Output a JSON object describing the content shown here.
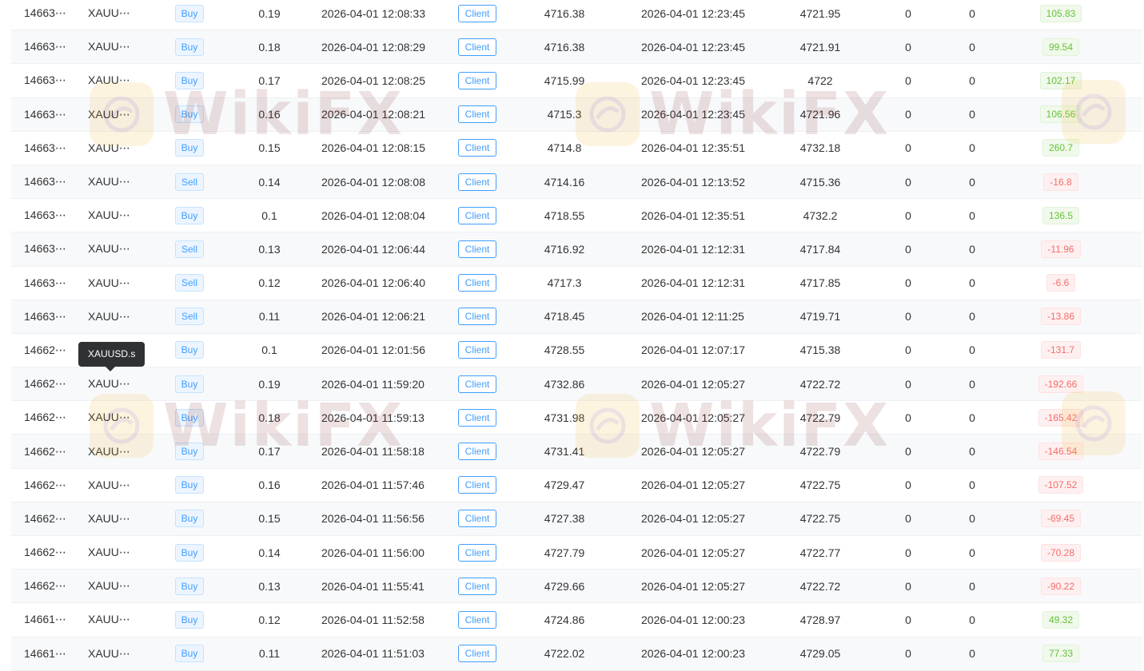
{
  "tooltip": {
    "text": "XAUUSD.s"
  },
  "watermark": {
    "text": "WikiFX"
  },
  "colors": {
    "primary": "#409eff",
    "profit": "#67c23a",
    "loss": "#f56c6c",
    "tooltip_bg": "#303133"
  },
  "rows": [
    {
      "id": "14663⋯",
      "symbol": "XAUU⋯",
      "type": "Buy",
      "volume": "0.19",
      "open_time": "2026-04-01 12:08:33",
      "source": "Client",
      "open_price": "4716.38",
      "close_time": "2026-04-01 12:23:45",
      "close_price": "4721.95",
      "swap": "0",
      "commission": "0",
      "profit": "105.83",
      "profit_sign": "pos"
    },
    {
      "id": "14663⋯",
      "symbol": "XAUU⋯",
      "type": "Buy",
      "volume": "0.18",
      "open_time": "2026-04-01 12:08:29",
      "source": "Client",
      "open_price": "4716.38",
      "close_time": "2026-04-01 12:23:45",
      "close_price": "4721.91",
      "swap": "0",
      "commission": "0",
      "profit": "99.54",
      "profit_sign": "pos"
    },
    {
      "id": "14663⋯",
      "symbol": "XAUU⋯",
      "type": "Buy",
      "volume": "0.17",
      "open_time": "2026-04-01 12:08:25",
      "source": "Client",
      "open_price": "4715.99",
      "close_time": "2026-04-01 12:23:45",
      "close_price": "4722",
      "swap": "0",
      "commission": "0",
      "profit": "102.17",
      "profit_sign": "pos"
    },
    {
      "id": "14663⋯",
      "symbol": "XAUU⋯",
      "type": "Buy",
      "volume": "0.16",
      "open_time": "2026-04-01 12:08:21",
      "source": "Client",
      "open_price": "4715.3",
      "close_time": "2026-04-01 12:23:45",
      "close_price": "4721.96",
      "swap": "0",
      "commission": "0",
      "profit": "106.56",
      "profit_sign": "pos"
    },
    {
      "id": "14663⋯",
      "symbol": "XAUU⋯",
      "type": "Buy",
      "volume": "0.15",
      "open_time": "2026-04-01 12:08:15",
      "source": "Client",
      "open_price": "4714.8",
      "close_time": "2026-04-01 12:35:51",
      "close_price": "4732.18",
      "swap": "0",
      "commission": "0",
      "profit": "260.7",
      "profit_sign": "pos"
    },
    {
      "id": "14663⋯",
      "symbol": "XAUU⋯",
      "type": "Sell",
      "volume": "0.14",
      "open_time": "2026-04-01 12:08:08",
      "source": "Client",
      "open_price": "4714.16",
      "close_time": "2026-04-01 12:13:52",
      "close_price": "4715.36",
      "swap": "0",
      "commission": "0",
      "profit": "-16.8",
      "profit_sign": "neg"
    },
    {
      "id": "14663⋯",
      "symbol": "XAUU⋯",
      "type": "Buy",
      "volume": "0.1",
      "open_time": "2026-04-01 12:08:04",
      "source": "Client",
      "open_price": "4718.55",
      "close_time": "2026-04-01 12:35:51",
      "close_price": "4732.2",
      "swap": "0",
      "commission": "0",
      "profit": "136.5",
      "profit_sign": "pos"
    },
    {
      "id": "14663⋯",
      "symbol": "XAUU⋯",
      "type": "Sell",
      "volume": "0.13",
      "open_time": "2026-04-01 12:06:44",
      "source": "Client",
      "open_price": "4716.92",
      "close_time": "2026-04-01 12:12:31",
      "close_price": "4717.84",
      "swap": "0",
      "commission": "0",
      "profit": "-11.96",
      "profit_sign": "neg"
    },
    {
      "id": "14663⋯",
      "symbol": "XAUU⋯",
      "type": "Sell",
      "volume": "0.12",
      "open_time": "2026-04-01 12:06:40",
      "source": "Client",
      "open_price": "4717.3",
      "close_time": "2026-04-01 12:12:31",
      "close_price": "4717.85",
      "swap": "0",
      "commission": "0",
      "profit": "-6.6",
      "profit_sign": "neg"
    },
    {
      "id": "14663⋯",
      "symbol": "XAUU⋯",
      "type": "Sell",
      "volume": "0.11",
      "open_time": "2026-04-01 12:06:21",
      "source": "Client",
      "open_price": "4718.45",
      "close_time": "2026-04-01 12:11:25",
      "close_price": "4719.71",
      "swap": "0",
      "commission": "0",
      "profit": "-13.86",
      "profit_sign": "neg"
    },
    {
      "id": "14662⋯",
      "symbol": "",
      "type": "Buy",
      "volume": "0.1",
      "open_time": "2026-04-01 12:01:56",
      "source": "Client",
      "open_price": "4728.55",
      "close_time": "2026-04-01 12:07:17",
      "close_price": "4715.38",
      "swap": "0",
      "commission": "0",
      "profit": "-131.7",
      "profit_sign": "neg"
    },
    {
      "id": "14662⋯",
      "symbol": "XAUU⋯",
      "type": "Buy",
      "volume": "0.19",
      "open_time": "2026-04-01 11:59:20",
      "source": "Client",
      "open_price": "4732.86",
      "close_time": "2026-04-01 12:05:27",
      "close_price": "4722.72",
      "swap": "0",
      "commission": "0",
      "profit": "-192.66",
      "profit_sign": "neg"
    },
    {
      "id": "14662⋯",
      "symbol": "XAUU⋯",
      "type": "Buy",
      "volume": "0.18",
      "open_time": "2026-04-01 11:59:13",
      "source": "Client",
      "open_price": "4731.98",
      "close_time": "2026-04-01 12:05:27",
      "close_price": "4722.79",
      "swap": "0",
      "commission": "0",
      "profit": "-165.42",
      "profit_sign": "neg"
    },
    {
      "id": "14662⋯",
      "symbol": "XAUU⋯",
      "type": "Buy",
      "volume": "0.17",
      "open_time": "2026-04-01 11:58:18",
      "source": "Client",
      "open_price": "4731.41",
      "close_time": "2026-04-01 12:05:27",
      "close_price": "4722.79",
      "swap": "0",
      "commission": "0",
      "profit": "-146.54",
      "profit_sign": "neg"
    },
    {
      "id": "14662⋯",
      "symbol": "XAUU⋯",
      "type": "Buy",
      "volume": "0.16",
      "open_time": "2026-04-01 11:57:46",
      "source": "Client",
      "open_price": "4729.47",
      "close_time": "2026-04-01 12:05:27",
      "close_price": "4722.75",
      "swap": "0",
      "commission": "0",
      "profit": "-107.52",
      "profit_sign": "neg"
    },
    {
      "id": "14662⋯",
      "symbol": "XAUU⋯",
      "type": "Buy",
      "volume": "0.15",
      "open_time": "2026-04-01 11:56:56",
      "source": "Client",
      "open_price": "4727.38",
      "close_time": "2026-04-01 12:05:27",
      "close_price": "4722.75",
      "swap": "0",
      "commission": "0",
      "profit": "-69.45",
      "profit_sign": "neg"
    },
    {
      "id": "14662⋯",
      "symbol": "XAUU⋯",
      "type": "Buy",
      "volume": "0.14",
      "open_time": "2026-04-01 11:56:00",
      "source": "Client",
      "open_price": "4727.79",
      "close_time": "2026-04-01 12:05:27",
      "close_price": "4722.77",
      "swap": "0",
      "commission": "0",
      "profit": "-70.28",
      "profit_sign": "neg"
    },
    {
      "id": "14662⋯",
      "symbol": "XAUU⋯",
      "type": "Buy",
      "volume": "0.13",
      "open_time": "2026-04-01 11:55:41",
      "source": "Client",
      "open_price": "4729.66",
      "close_time": "2026-04-01 12:05:27",
      "close_price": "4722.72",
      "swap": "0",
      "commission": "0",
      "profit": "-90.22",
      "profit_sign": "neg"
    },
    {
      "id": "14661⋯",
      "symbol": "XAUU⋯",
      "type": "Buy",
      "volume": "0.12",
      "open_time": "2026-04-01 11:52:58",
      "source": "Client",
      "open_price": "4724.86",
      "close_time": "2026-04-01 12:00:23",
      "close_price": "4728.97",
      "swap": "0",
      "commission": "0",
      "profit": "49.32",
      "profit_sign": "pos"
    },
    {
      "id": "14661⋯",
      "symbol": "XAUU⋯",
      "type": "Buy",
      "volume": "0.11",
      "open_time": "2026-04-01 11:51:03",
      "source": "Client",
      "open_price": "4722.02",
      "close_time": "2026-04-01 12:00:23",
      "close_price": "4729.05",
      "swap": "0",
      "commission": "0",
      "profit": "77.33",
      "profit_sign": "pos"
    }
  ]
}
